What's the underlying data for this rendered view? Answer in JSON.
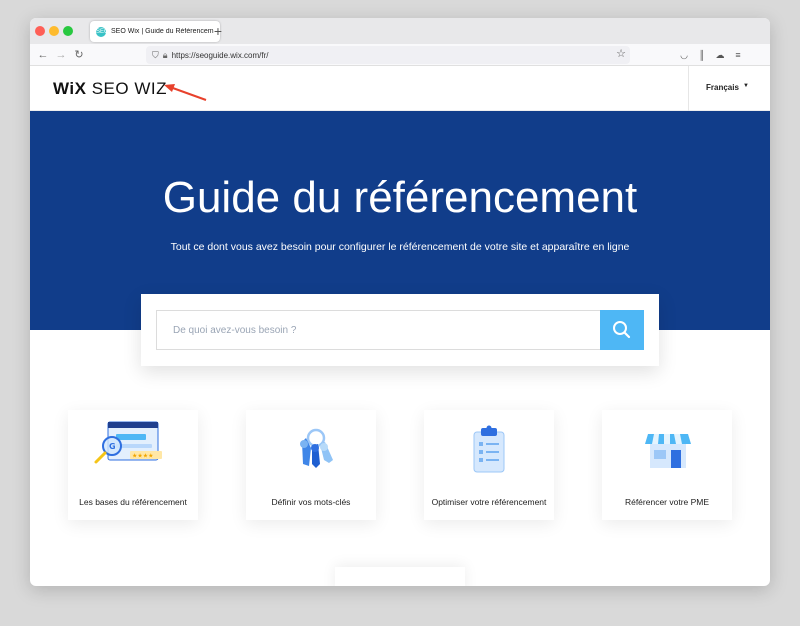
{
  "browser": {
    "tab_title": "SEO Wix | Guide du Référencem",
    "favicon_letter": "SEO",
    "url": "https://seoguide.wix.com/fr/",
    "new_tab": "+"
  },
  "header": {
    "logo_bold": "WiX",
    "logo_rest": " SEO WIZ",
    "language": "Français",
    "accent_arrow_color": "#e8412c"
  },
  "hero": {
    "title": "Guide du référencement",
    "subtitle": "Tout ce dont vous avez besoin pour configurer le référencement de votre site et apparaître en ligne",
    "background": "#113d8a"
  },
  "search": {
    "placeholder": "De quoi avez-vous besoin ?",
    "button_color": "#4eb7f5"
  },
  "categories": [
    {
      "label": "Les bases du référencement",
      "icon": "search-results-icon"
    },
    {
      "label": "Définir vos mots-clés",
      "icon": "keys-icon"
    },
    {
      "label": "Optimiser votre référencement",
      "icon": "clipboard-icon"
    },
    {
      "label": "Référencer votre PME",
      "icon": "storefront-icon"
    }
  ]
}
